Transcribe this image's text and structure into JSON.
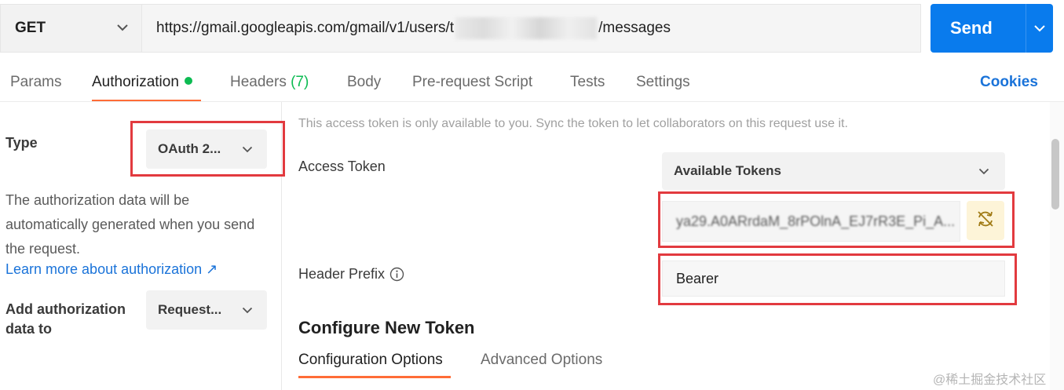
{
  "request": {
    "method": "GET",
    "url_prefix": "https://gmail.googleapis.com/gmail/v1/users/t",
    "url_suffix": "/messages",
    "send_label": "Send"
  },
  "tabs": [
    {
      "label": "Params"
    },
    {
      "label": "Authorization"
    },
    {
      "label": "Headers",
      "count": "(7)"
    },
    {
      "label": "Body"
    },
    {
      "label": "Pre-request Script"
    },
    {
      "label": "Tests"
    },
    {
      "label": "Settings"
    }
  ],
  "cookies_label": "Cookies",
  "auth": {
    "type_label": "Type",
    "type_value": "OAuth 2...",
    "description": "The authorization data will be automatically generated when you send the request.",
    "learn_more": "Learn more about authorization ↗",
    "add_label": "Add authorization data to",
    "add_value": "Request..."
  },
  "token": {
    "info": "This access token is only available to you. Sync the token to let collaborators on this request use it.",
    "access_token_label": "Access Token",
    "available_tokens": "Available Tokens",
    "token_value": "ya29.A0ARrdaM_8rPOlnA_EJ7rR3E_Pi_A...",
    "header_prefix_label": "Header Prefix",
    "header_prefix_value": "Bearer"
  },
  "configure": {
    "title": "Configure New Token",
    "tabs": [
      "Configuration Options",
      "Advanced Options"
    ]
  },
  "watermark": "@稀土掘金技术社区",
  "colors": {
    "accent": "#ff6c37",
    "send": "#097bed",
    "link": "#1a73d9",
    "green": "#0cbb52",
    "highlight": "#e23a3f"
  }
}
